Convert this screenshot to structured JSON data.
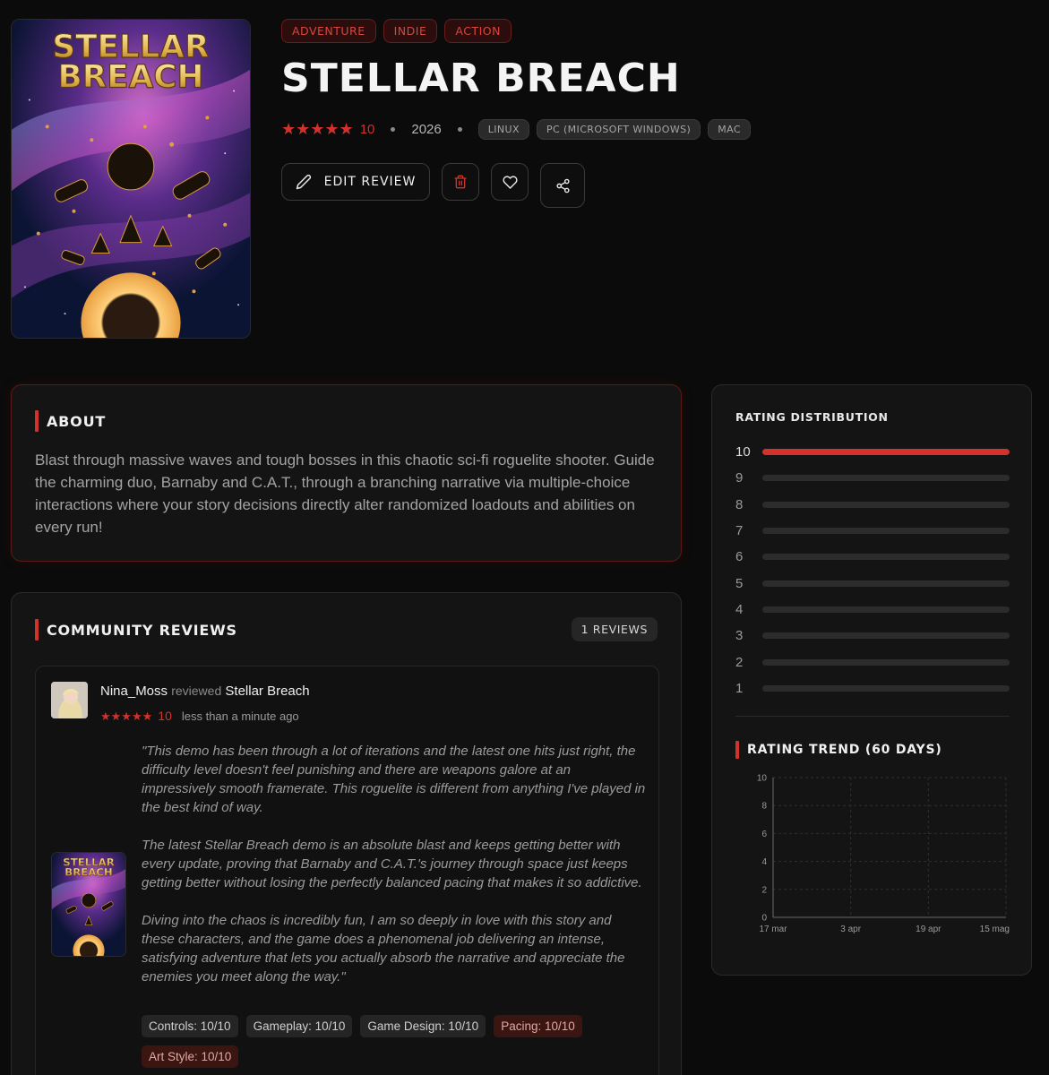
{
  "game": {
    "title": "STELLAR BREACH",
    "cover_logo_line1": "STELLAR",
    "cover_logo_line2": "BREACH",
    "genres": [
      "ADVENTURE",
      "INDIE",
      "ACTION"
    ],
    "rating": "10",
    "stars": "★★★★★",
    "year": "2026",
    "platforms": [
      "LINUX",
      "PC (MICROSOFT WINDOWS)",
      "MAC"
    ]
  },
  "actions": {
    "edit_label": "EDIT REVIEW",
    "delete_icon": "trash-icon",
    "like_icon": "heart-icon",
    "share_icon": "share-icon"
  },
  "about": {
    "heading": "ABOUT",
    "text": "Blast through massive waves and tough bosses in this chaotic sci-fi roguelite shooter. Guide the charming duo, Barnaby and C.A.T., through a branching narrative via multiple-choice interactions where your story decisions directly alter randomized loadouts and abilities on every run!"
  },
  "reviews": {
    "heading": "COMMUNITY REVIEWS",
    "count_label": "1 REVIEWS",
    "items": [
      {
        "user": "Nina_Moss",
        "verb": "reviewed",
        "game": "Stellar Breach",
        "stars": "★★★★★",
        "rating": "10",
        "time": "less than a minute ago",
        "paragraphs": [
          "\"This demo has been through a lot of iterations and the latest one hits just right, the difficulty level doesn't feel punishing and there are weapons galore at an impressively smooth framerate. This roguelite is different from anything I've played in the best kind of way.",
          "The latest Stellar Breach demo is an absolute blast and keeps getting better with every update, proving that Barnaby and C.A.T.'s journey through space just keeps getting better without losing the perfectly balanced pacing that makes it so addictive.",
          "Diving into the chaos is incredibly fun, I am so deeply in love with this story and these characters, and the game does a phenomenal job delivering an intense, satisfying adventure that lets you actually absorb the narrative and appreciate the enemies you meet along the way.\""
        ],
        "criteria": [
          {
            "label": "Controls: 10/10",
            "highlight": false
          },
          {
            "label": "Gameplay: 10/10",
            "highlight": false
          },
          {
            "label": "Game Design: 10/10",
            "highlight": false
          },
          {
            "label": "Pacing: 10/10",
            "highlight": true
          },
          {
            "label": "Art Style: 10/10",
            "highlight": true
          }
        ]
      }
    ]
  },
  "distribution": {
    "heading": "RATING DISTRIBUTION",
    "rows": [
      {
        "label": "10",
        "fraction": 1.0
      },
      {
        "label": "9",
        "fraction": 0
      },
      {
        "label": "8",
        "fraction": 0
      },
      {
        "label": "7",
        "fraction": 0
      },
      {
        "label": "6",
        "fraction": 0
      },
      {
        "label": "5",
        "fraction": 0
      },
      {
        "label": "4",
        "fraction": 0
      },
      {
        "label": "3",
        "fraction": 0
      },
      {
        "label": "2",
        "fraction": 0
      },
      {
        "label": "1",
        "fraction": 0
      }
    ]
  },
  "trend": {
    "heading": "RATING TREND (60 DAYS)"
  },
  "chart_data": {
    "type": "line",
    "title": "RATING TREND (60 DAYS)",
    "x_ticks": [
      "17 mar",
      "3 apr",
      "19 apr",
      "15 mag"
    ],
    "y_ticks": [
      "0",
      "2",
      "4",
      "6",
      "8",
      "10"
    ],
    "ylim": [
      0,
      10
    ],
    "series": [],
    "grid": true
  },
  "colors": {
    "accent": "#d3322b",
    "background": "#0b0b0b",
    "panel": "#141414"
  }
}
